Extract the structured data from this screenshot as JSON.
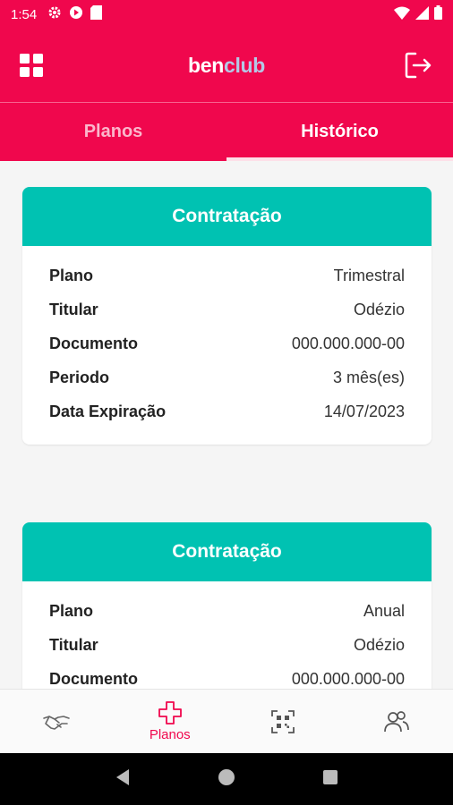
{
  "status": {
    "time": "1:54"
  },
  "header": {
    "brand_ben": "ben",
    "brand_club": "club"
  },
  "tabs": [
    {
      "label": "Planos"
    },
    {
      "label": "Histórico"
    }
  ],
  "cards": [
    {
      "title": "Contratação",
      "rows": [
        {
          "key": "Plano",
          "value": "Trimestral"
        },
        {
          "key": "Titular",
          "value": "Odézio"
        },
        {
          "key": "Documento",
          "value": "000.000.000-00"
        },
        {
          "key": "Periodo",
          "value": "3 mês(es)"
        },
        {
          "key": "Data Expiração",
          "value": "14/07/2023"
        }
      ]
    },
    {
      "title": "Contratação",
      "rows": [
        {
          "key": "Plano",
          "value": "Anual"
        },
        {
          "key": "Titular",
          "value": "Odézio"
        },
        {
          "key": "Documento",
          "value": "000.000.000-00"
        }
      ]
    }
  ],
  "bottom_nav": {
    "planos_label": "Planos"
  },
  "colors": {
    "primary": "#f0074d",
    "teal": "#00c2b2"
  }
}
